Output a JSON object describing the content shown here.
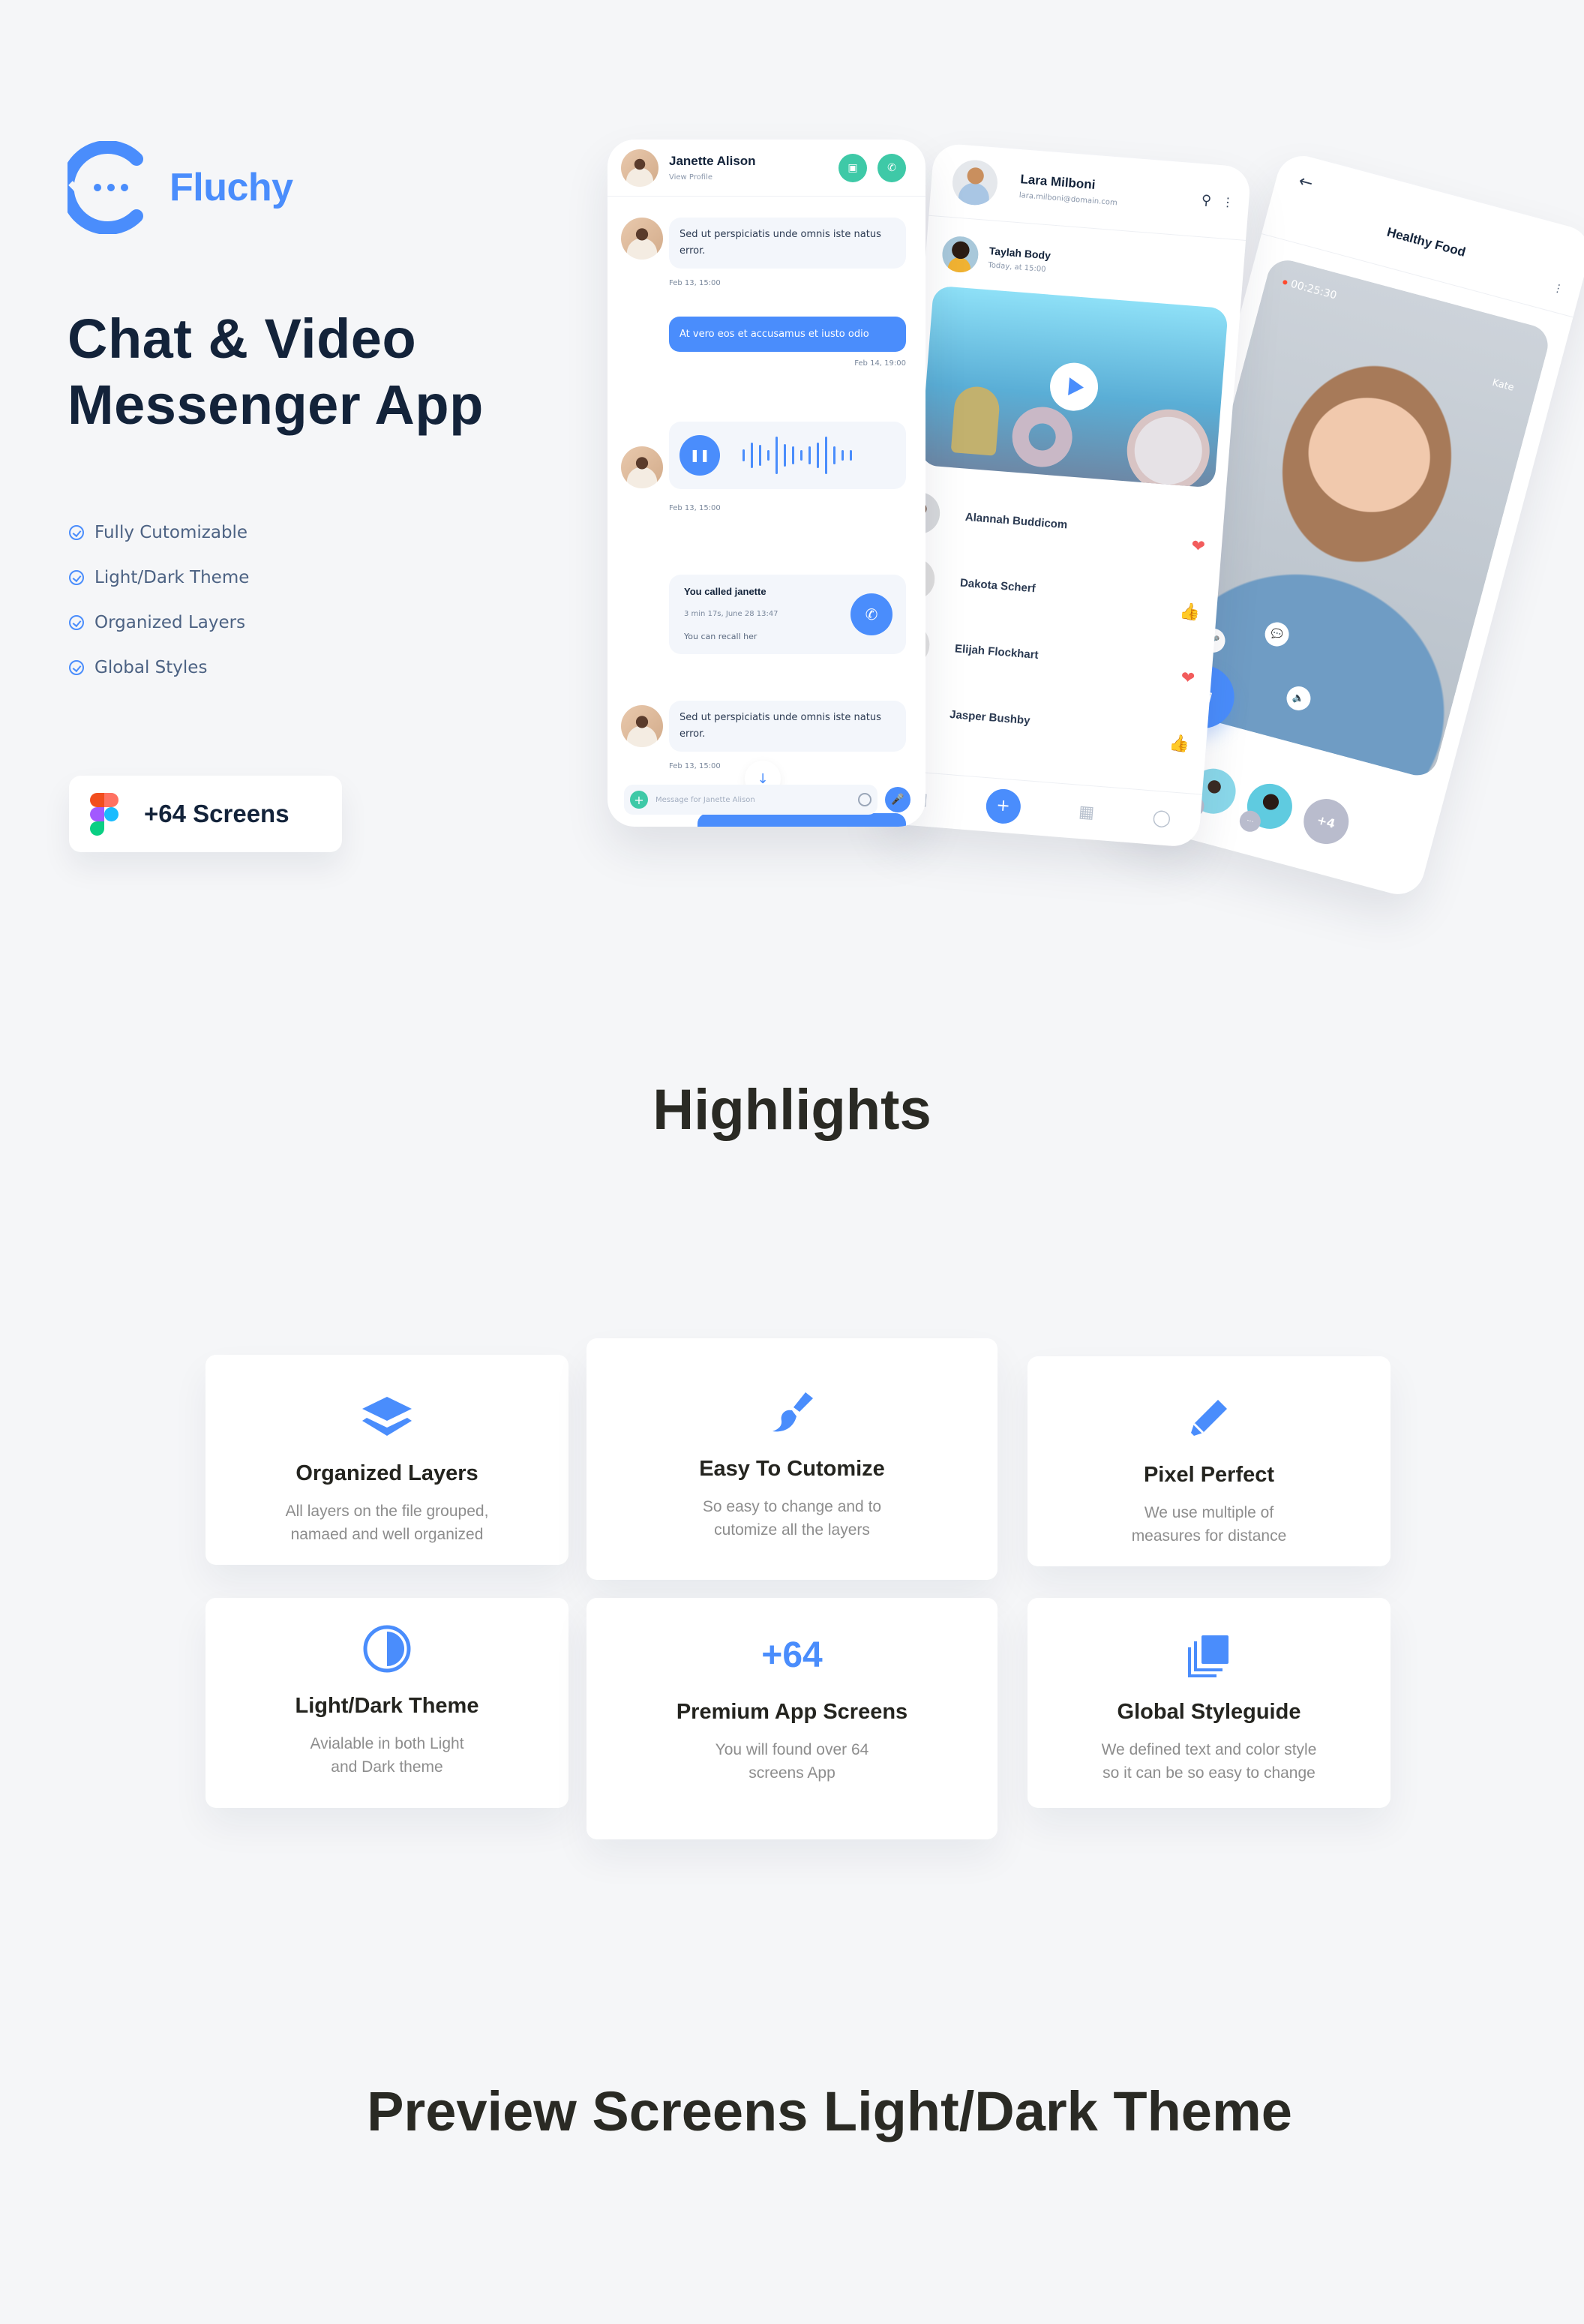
{
  "brand": {
    "name": "Fluchy",
    "accent_color": "#4a8dfc"
  },
  "hero": {
    "title_line1": "Chat & Video",
    "title_line2": "Messenger App",
    "features": [
      "Fully Cutomizable",
      "Light/Dark Theme",
      "Organized Layers",
      "Global Styles"
    ],
    "badge": {
      "icon": "figma-logo-icon",
      "label": "+64 Screens"
    }
  },
  "chat_screen": {
    "contact_name": "Janette Alison",
    "contact_sub": "View Profile",
    "header_actions": [
      "video-call-icon",
      "phone-call-icon"
    ],
    "messages": [
      {
        "type": "incoming",
        "text": "Sed ut perspiciatis unde omnis iste natus error.",
        "time": "Feb 13, 15:00"
      },
      {
        "type": "outgoing",
        "text": "At vero eos et accusamus et iusto odio",
        "time": "Feb 14, 19:00"
      },
      {
        "type": "voice",
        "time": "Feb 13, 15:00"
      },
      {
        "type": "call",
        "title": "You called janette",
        "detail": "3 min 17s, June 28 13:47",
        "note": "You can recall her"
      },
      {
        "type": "incoming",
        "text": "Sed ut perspiciatis unde omnis iste natus error.",
        "time": "Feb 13, 15:00"
      }
    ],
    "composer_placeholder": "Message for Janette Alison"
  },
  "feed_screen": {
    "user_name": "Lara Milboni",
    "user_email": "lara.milboni@domain.com",
    "post": {
      "author": "Taylah Body",
      "time": "Today, at 15:00"
    },
    "contacts": [
      {
        "name": "Alannah Buddicom",
        "reaction": "heart"
      },
      {
        "name": "Dakota Scherf",
        "reaction": "like"
      },
      {
        "name": "Elijah Flockhart",
        "reaction": "heart"
      },
      {
        "name": "Jasper Bushby",
        "reaction": "like"
      }
    ],
    "tabbar": [
      "video-icon",
      "add-icon",
      "grid-icon",
      "profile-icon"
    ],
    "add_label": "+"
  },
  "call_screen": {
    "title": "Healthy Food",
    "timer": "00:25:30",
    "participant_name": "Kate",
    "more_participants": "+4"
  },
  "highlights": {
    "title": "Highlights",
    "cards": [
      {
        "icon": "layers-icon",
        "title": "Organized Layers",
        "desc_line1": "All layers on the file grouped,",
        "desc_line2": "namaed and  well organized"
      },
      {
        "icon": "brush-icon",
        "title": "Easy To Cutomize",
        "desc_line1": "So easy to change and to",
        "desc_line2": "cutomize all the layers"
      },
      {
        "icon": "pen-icon",
        "title": "Pixel Perfect",
        "desc_line1": "We use multiple of",
        "desc_line2": "measures for distance"
      },
      {
        "icon": "contrast-icon",
        "title": "Light/Dark Theme",
        "desc_line1": "Avialable in both Light",
        "desc_line2": "and Dark theme"
      },
      {
        "icon_text": "+64",
        "title": "Premium App Screens",
        "desc_line1": "You will found over 64",
        "desc_line2": "screens App"
      },
      {
        "icon": "copy-stack-icon",
        "title": "Global Styleguide",
        "desc_line1": "We defined text and color style",
        "desc_line2": "so it can be so easy to change"
      }
    ]
  },
  "preview": {
    "title": "Preview Screens Light/Dark Theme"
  }
}
